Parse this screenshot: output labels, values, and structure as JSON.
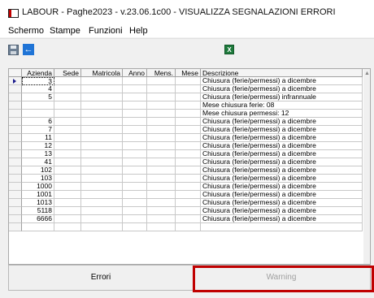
{
  "window": {
    "title": "LABOUR - Paghe2023 - v.23.06.1c00 - VISUALIZZA SEGNALAZIONI ERRORI"
  },
  "menu": [
    "Schermo",
    "Stampe",
    "Funzioni",
    "Help"
  ],
  "toolbar": {
    "save_icon": "save-icon",
    "back_icon": "back-arrow-icon",
    "excel_icon": "excel-export-icon",
    "excel_glyph": "X"
  },
  "grid": {
    "columns": [
      "Azienda",
      "Sede",
      "Matricola",
      "Anno",
      "Mens.",
      "Mese",
      "Descrizione"
    ],
    "rows": [
      {
        "azienda": "3",
        "descrizione": "Chiusura (ferie/permessi) a dicembre",
        "selected": true
      },
      {
        "azienda": "4",
        "descrizione": "Chiusura (ferie/permessi) a dicembre"
      },
      {
        "azienda": "5",
        "descrizione": "Chiusura (ferie/permessi) infrannuale"
      },
      {
        "azienda": "",
        "descrizione": "Mese chiusura ferie: 08"
      },
      {
        "azienda": "",
        "descrizione": "Mese chiusura permessi: 12"
      },
      {
        "azienda": "6",
        "descrizione": "Chiusura (ferie/permessi) a dicembre"
      },
      {
        "azienda": "7",
        "descrizione": "Chiusura (ferie/permessi) a dicembre"
      },
      {
        "azienda": "11",
        "descrizione": "Chiusura (ferie/permessi) a dicembre"
      },
      {
        "azienda": "12",
        "descrizione": "Chiusura (ferie/permessi) a dicembre"
      },
      {
        "azienda": "13",
        "descrizione": "Chiusura (ferie/permessi) a dicembre"
      },
      {
        "azienda": "41",
        "descrizione": "Chiusura (ferie/permessi) a dicembre"
      },
      {
        "azienda": "102",
        "descrizione": "Chiusura (ferie/permessi) a dicembre"
      },
      {
        "azienda": "103",
        "descrizione": "Chiusura (ferie/permessi) a dicembre"
      },
      {
        "azienda": "1000",
        "descrizione": "Chiusura (ferie/permessi) a dicembre"
      },
      {
        "azienda": "1001",
        "descrizione": "Chiusura (ferie/permessi) a dicembre"
      },
      {
        "azienda": "1013",
        "descrizione": "Chiusura (ferie/permessi) a dicembre"
      },
      {
        "azienda": "5118",
        "descrizione": "Chiusura (ferie/permessi) a dicembre"
      },
      {
        "azienda": "6666",
        "descrizione": "Chiusura (ferie/permessi) a dicembre"
      },
      {
        "azienda": "",
        "descrizione": ""
      }
    ]
  },
  "tabs": {
    "errori": "Errori",
    "warning": "Warning",
    "active": "errori"
  }
}
